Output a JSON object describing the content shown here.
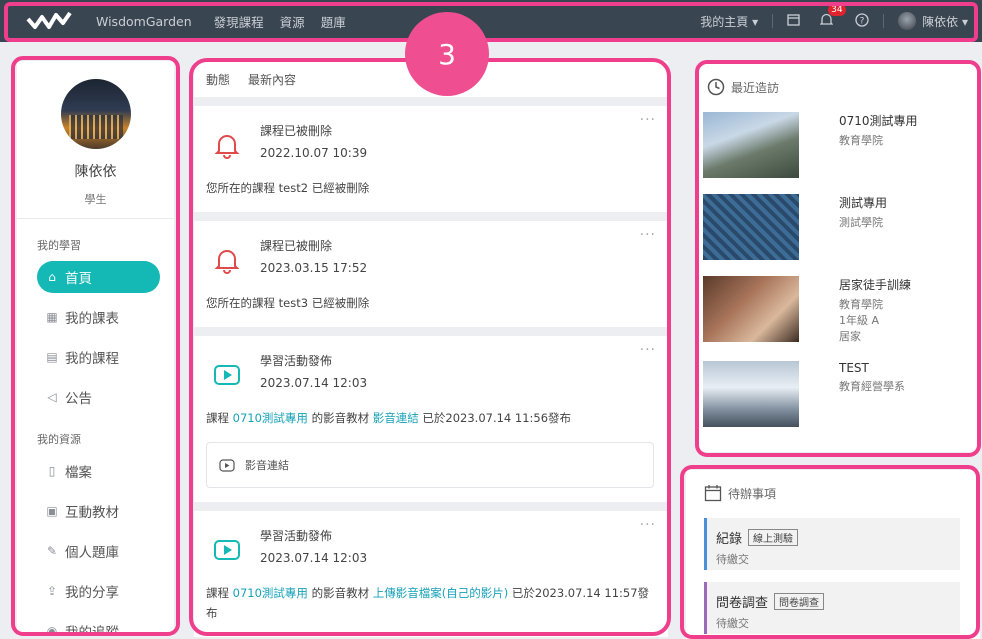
{
  "nav": {
    "brand": "WisdomGarden",
    "links": [
      "發現課程",
      "資源",
      "題庫"
    ],
    "my_home": "我的主頁",
    "notif_count": "34",
    "user_name": "陳依依"
  },
  "callout_number": "3",
  "sidebar": {
    "name": "陳依依",
    "role": "學生",
    "section_learning": "我的學習",
    "items_learning": [
      "首頁",
      "我的課表",
      "我的課程",
      "公告"
    ],
    "section_resources": "我的資源",
    "items_resources": [
      "檔案",
      "互動教材",
      "個人題庫",
      "我的分享",
      "我的追蹤"
    ]
  },
  "feed": {
    "tabs": [
      "動態",
      "最新內容"
    ],
    "cards": [
      {
        "title": "課程已被刪除",
        "time": "2022.10.07 10:39",
        "body": "您所在的課程 test2 已經被刪除"
      },
      {
        "title": "課程已被刪除",
        "time": "2023.03.15 17:52",
        "body": "您所在的課程 test3 已經被刪除"
      },
      {
        "title": "學習活動發佈",
        "time": "2023.07.14 12:03",
        "body_pre": "課程 ",
        "course": "0710測試專用",
        "body_mid": " 的影音教材 ",
        "material": "影音連結",
        "body_post": " 已於2023.07.14 11:56發布",
        "attachment": "影音連結"
      },
      {
        "title": "學習活動發佈",
        "time": "2023.07.14 12:03",
        "body_pre": "課程 ",
        "course": "0710測試專用",
        "body_mid": " 的影音教材 ",
        "material": "上傳影音檔案(自己的影片)",
        "body_post": " 已於2023.07.14 11:57發布"
      }
    ]
  },
  "recent": {
    "title": "最近造訪",
    "items": [
      {
        "name": "0710測試專用",
        "sub": [
          "教育學院"
        ]
      },
      {
        "name": "測試專用",
        "sub": [
          "測試學院"
        ]
      },
      {
        "name": "居家徒手訓練",
        "sub": [
          "教育學院",
          "1年級 A",
          "居家"
        ]
      },
      {
        "name": "TEST",
        "sub": [
          "教育經營學系"
        ]
      }
    ]
  },
  "todo": {
    "title": "待辦事項",
    "items": [
      {
        "name": "紀錄",
        "tag": "線上測驗",
        "status": "待繳交",
        "color": "#4a90d9"
      },
      {
        "name": "問卷調查",
        "tag": "問卷調查",
        "status": "待繳交",
        "color": "#9b6ab8"
      }
    ]
  },
  "colors": {
    "accent": "#14b8b4",
    "nav_bg": "#3a4552",
    "highlight": "#ef3f8c",
    "link": "#17a2b8",
    "alert": "#e04a4a"
  }
}
